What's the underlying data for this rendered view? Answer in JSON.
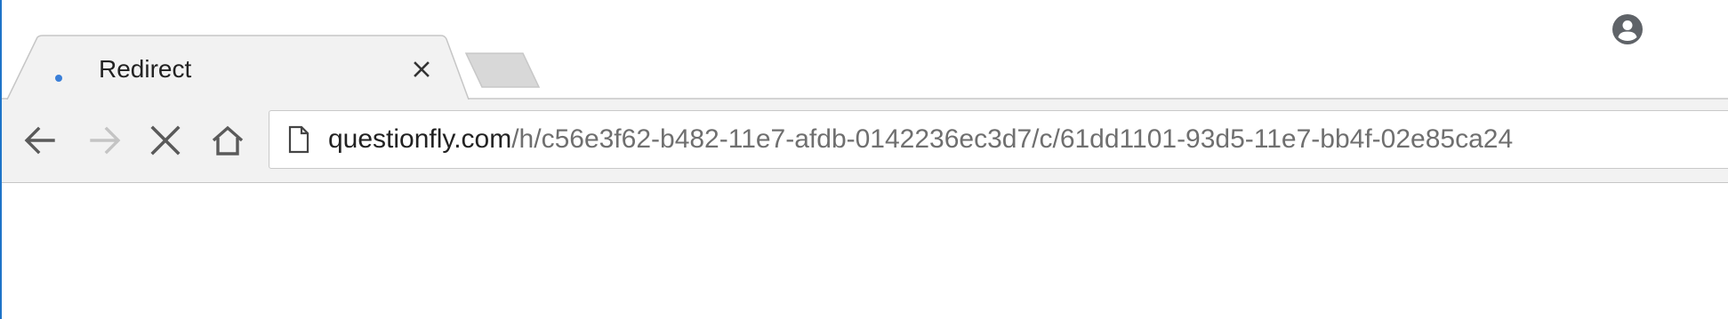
{
  "tab": {
    "title": "Redirect",
    "close_icon": "close-icon",
    "loading_icon": "loading-spinner-icon"
  },
  "new_tab": {
    "icon": "new-tab-icon"
  },
  "profile": {
    "icon": "account-circle-icon"
  },
  "toolbar": {
    "back_icon": "back-arrow-icon",
    "forward_icon": "forward-arrow-icon",
    "stop_icon": "stop-icon",
    "home_icon": "home-icon"
  },
  "omnibox": {
    "page_icon": "page-icon",
    "host": "questionfly.com",
    "path": "/h/c56e3f62-b482-11e7-afdb-0142236ec3d7/c/61dd1101-93d5-11e7-bb4f-02e85ca24"
  },
  "colors": {
    "accent": "#1e74c8",
    "spinner": "#3a7fd8",
    "toolbar_bg": "#f2f2f2",
    "tab_bg": "#f2f2f2",
    "url_host": "#222222",
    "url_path": "#6f6f6f"
  }
}
